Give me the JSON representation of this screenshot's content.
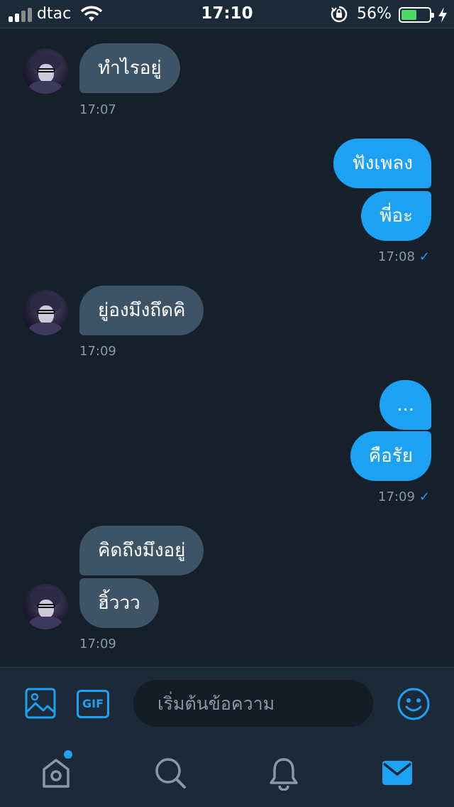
{
  "status_bar": {
    "carrier": "dtac",
    "time": "17:10",
    "battery_percent": "56%",
    "battery_level": 0.56
  },
  "conversation": {
    "messages": [
      {
        "direction": "incoming",
        "text": "ทำไรอยู่"
      },
      {
        "direction": "incoming_time",
        "time": "17:07"
      },
      {
        "direction": "outgoing",
        "text": "ฟังเพลง"
      },
      {
        "direction": "outgoing",
        "text": "พี่อะ"
      },
      {
        "direction": "outgoing_time",
        "time": "17:08",
        "read_mark": "✓"
      },
      {
        "direction": "incoming",
        "text": "ยู่องมึงถึดคิ"
      },
      {
        "direction": "incoming_time",
        "time": "17:09"
      },
      {
        "direction": "outgoing",
        "text": "..."
      },
      {
        "direction": "outgoing",
        "text": "คือรัย"
      },
      {
        "direction": "outgoing_time",
        "time": "17:09",
        "read_mark": "✓"
      },
      {
        "direction": "incoming",
        "text": "คิดถึงมึงอยู่"
      },
      {
        "direction": "incoming",
        "text": "ฮิ้ววว"
      },
      {
        "direction": "incoming_time",
        "time": "17:09"
      }
    ]
  },
  "composer": {
    "placeholder": "เริ่มต้นข้อความ",
    "gif_label": "GIF",
    "icons": [
      "image-icon",
      "gif-icon",
      "emoji-icon"
    ]
  },
  "tab_bar": {
    "tabs": [
      "home-icon",
      "search-icon",
      "notifications-icon",
      "messages-icon"
    ],
    "active_tab": "messages-icon",
    "home_has_new": true
  },
  "colors": {
    "background": "#15202b",
    "bars": "#1c2938",
    "incoming_bubble": "#3d5466",
    "outgoing_bubble": "#1da1f2",
    "muted_text": "#8899a6",
    "accent": "#1da1f2"
  }
}
